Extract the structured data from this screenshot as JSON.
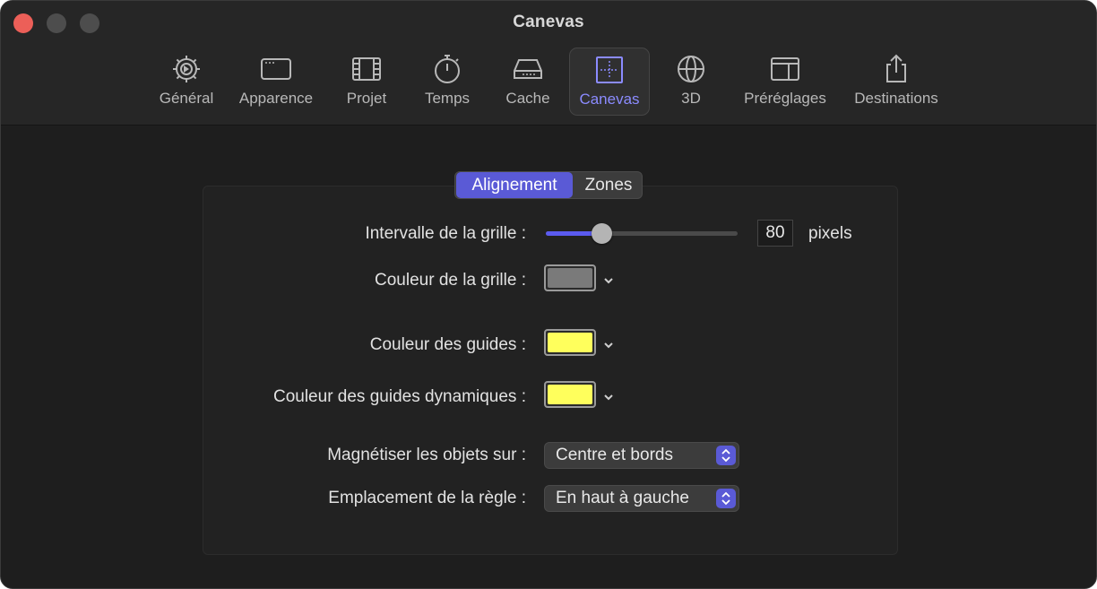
{
  "window": {
    "title": "Canevas"
  },
  "tabs": [
    {
      "label": "Général",
      "icon": "gear-icon"
    },
    {
      "label": "Apparence",
      "icon": "window-icon"
    },
    {
      "label": "Projet",
      "icon": "film-icon"
    },
    {
      "label": "Temps",
      "icon": "stopwatch-icon"
    },
    {
      "label": "Cache",
      "icon": "drive-icon"
    },
    {
      "label": "Canevas",
      "icon": "canvas-icon"
    },
    {
      "label": "3D",
      "icon": "sphere-icon"
    },
    {
      "label": "Préréglages",
      "icon": "presets-icon"
    },
    {
      "label": "Destinations",
      "icon": "share-icon"
    }
  ],
  "segments": {
    "selected": "Alignement",
    "other": "Zones"
  },
  "settings": {
    "grid_spacing_label": "Intervalle de la grille :",
    "grid_spacing_value": "80",
    "grid_spacing_unit": "pixels",
    "grid_spacing_slider_fraction": 0.29,
    "grid_color_label": "Couleur de la grille :",
    "grid_color": "#7a7a7a",
    "guide_color_label": "Couleur des guides :",
    "guide_color": "#ffff5c",
    "dynamic_guide_color_label": "Couleur des guides dynamiques :",
    "dynamic_guide_color": "#ffff5c",
    "snap_label": "Magnétiser les objets sur :",
    "snap_value": "Centre et bords",
    "ruler_label": "Emplacement de la règle :",
    "ruler_value": "En haut à gauche"
  },
  "colors": {
    "accent": "#5a5ad6",
    "active_tab_text": "#8b8bff"
  }
}
